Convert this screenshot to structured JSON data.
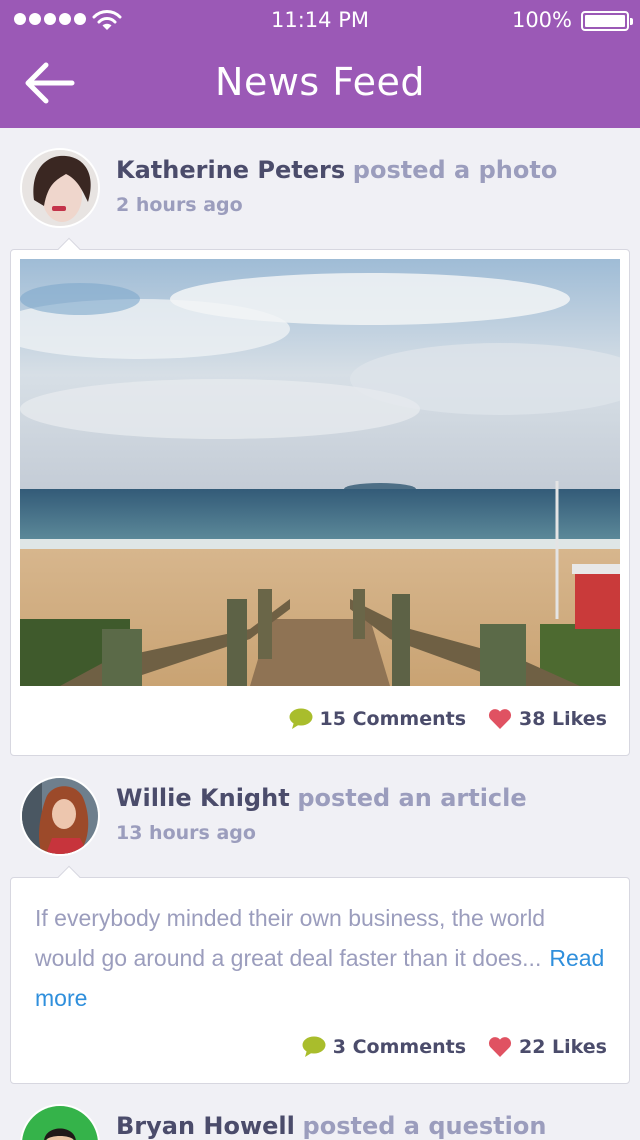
{
  "status_bar": {
    "time": "11:14 PM",
    "battery": "100%"
  },
  "header": {
    "title": "News Feed"
  },
  "icons": {
    "back": "arrow-left-icon",
    "comment": "speech-bubble-icon",
    "like": "heart-icon"
  },
  "colors": {
    "header_bg": "#9b59b6",
    "comment_icon": "#a9bd2c",
    "like_icon": "#e05262",
    "link": "#2f8fdc"
  },
  "posts": [
    {
      "author": "Katherine Peters",
      "action": "posted a photo",
      "time": "2 hours ago",
      "comments": "15 Comments",
      "likes": "38 Likes"
    },
    {
      "author": "Willie Knight",
      "action": "posted an article",
      "time": "13 hours ago",
      "excerpt": "If everybody minded their own business, the world would go around a great deal faster than it does...",
      "read_more": "Read more",
      "comments": "3 Comments",
      "likes": "22 Likes"
    },
    {
      "author": "Bryan Howell",
      "action": "posted a question"
    }
  ]
}
